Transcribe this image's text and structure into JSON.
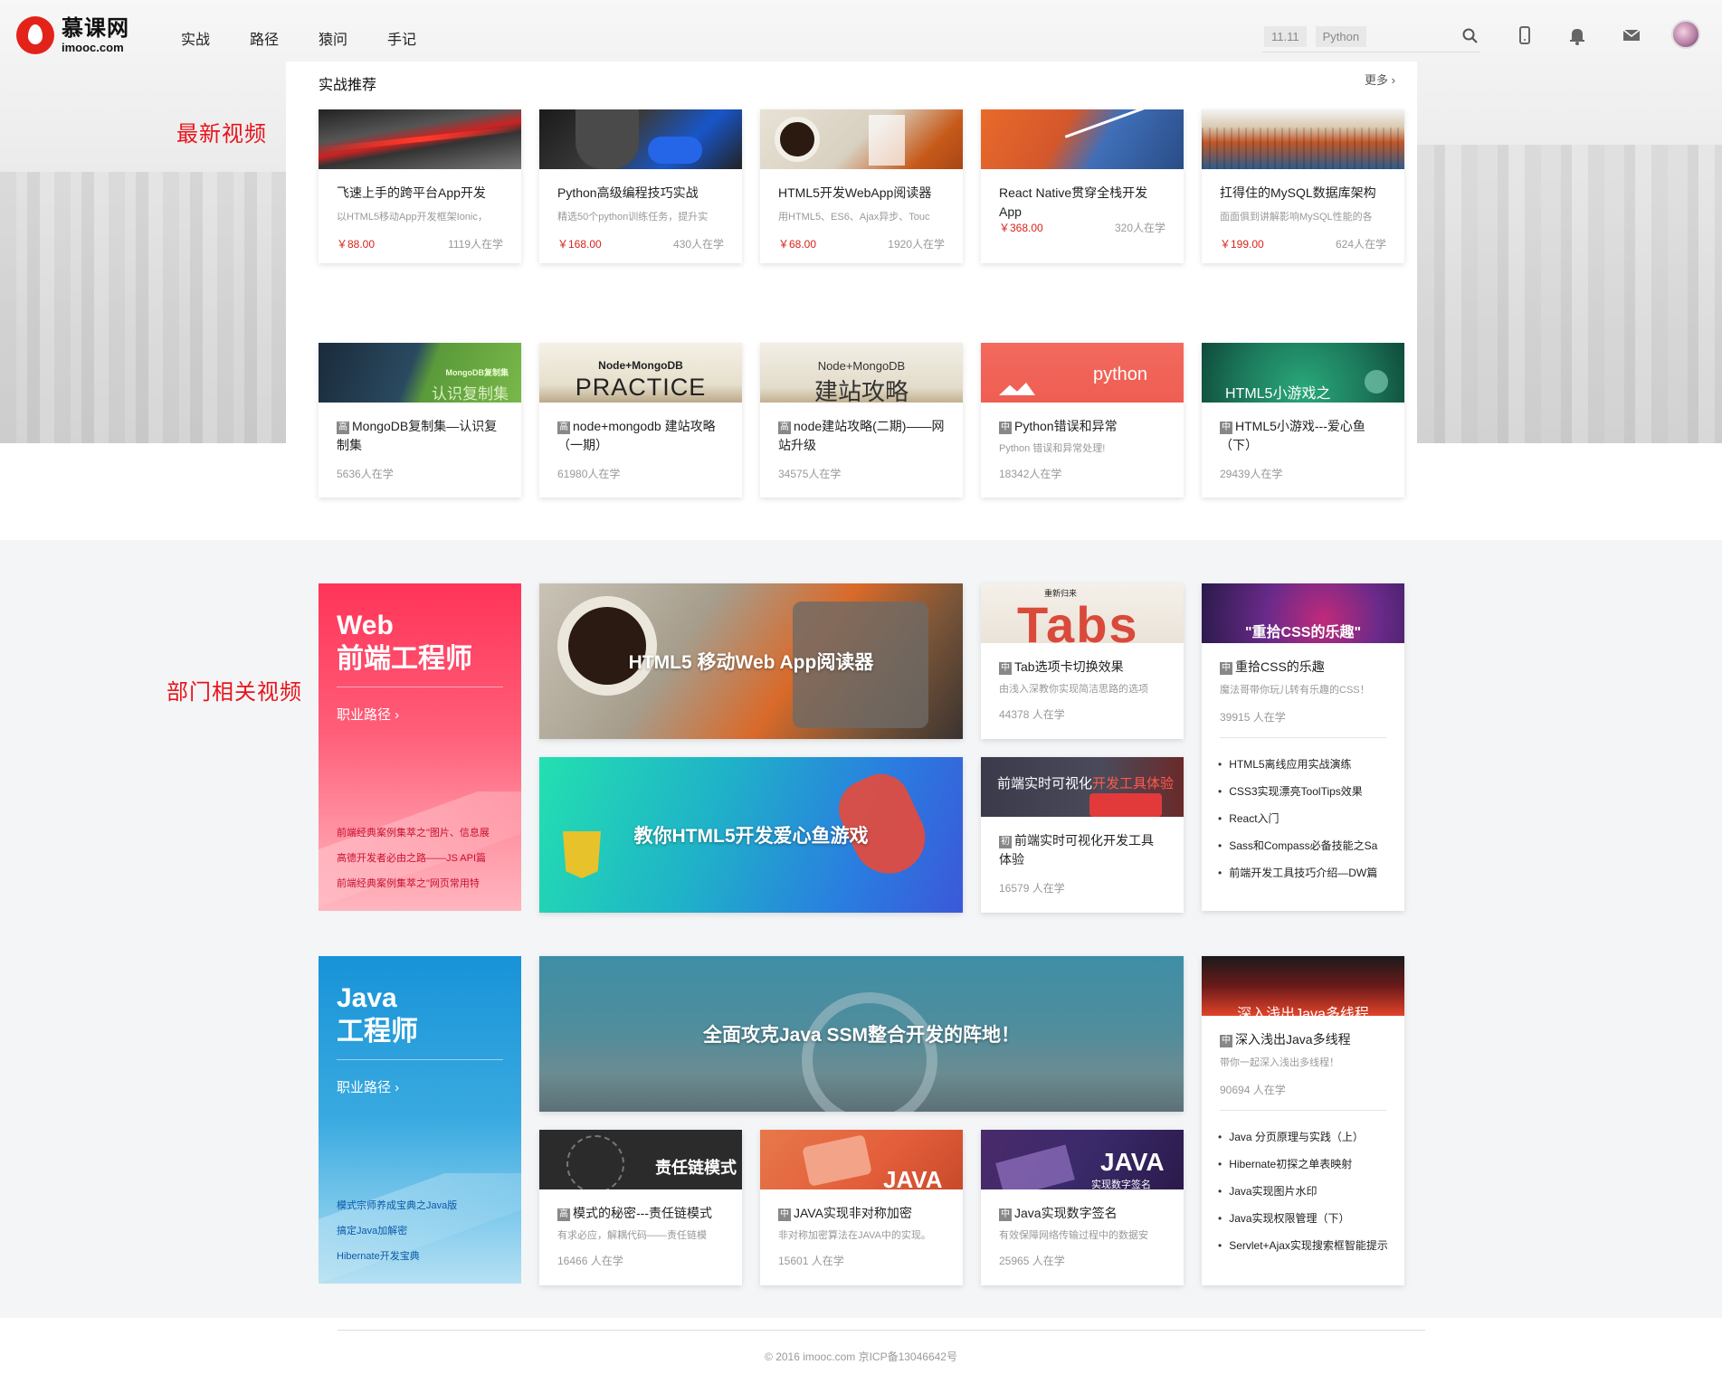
{
  "header": {
    "logo_cn": "慕课网",
    "logo_en": "imooc.com",
    "nav": [
      "实战",
      "路径",
      "猿问",
      "手记"
    ],
    "search_tags": [
      "11.11",
      "Python"
    ]
  },
  "side_labels": {
    "latest": "最新视频",
    "department": "部门相关视频"
  },
  "recommend": {
    "title": "实战推荐",
    "more": "更多 ›",
    "courses": [
      {
        "title": "飞速上手的跨平台App开发",
        "desc": "以HTML5移动App开发框架Ionic，",
        "price": "￥88.00",
        "students": "1119人在学"
      },
      {
        "title": "Python高级编程技巧实战",
        "desc": "精选50个python训练任务，提升实",
        "price": "￥168.00",
        "students": "430人在学"
      },
      {
        "title": "HTML5开发WebApp阅读器",
        "desc": "用HTML5、ES6、Ajax异步、Touc",
        "price": "￥68.00",
        "students": "1920人在学"
      },
      {
        "title": "React Native贯穿全栈开发App",
        "desc": "",
        "price": "￥368.00",
        "students": "320人在学"
      },
      {
        "title": "扛得住的MySQL数据库架构",
        "desc": "面面俱到讲解影响MySQL性能的各",
        "price": "￥199.00",
        "students": "624人在学"
      }
    ]
  },
  "latest": [
    {
      "level": "高",
      "title": "MongoDB复制集—认识复制集",
      "desc": "",
      "students": "5636人在学",
      "img_text": "认识复制集",
      "img_small": "MongoDB复制集"
    },
    {
      "level": "高",
      "title": "node+mongodb 建站攻略（一期）",
      "desc": "",
      "students": "61980人在学",
      "img_text": "PRACTICE",
      "img_small": "Node+MongoDB"
    },
    {
      "level": "高",
      "title": "node建站攻略(二期)——网站升级",
      "desc": "",
      "students": "34575人在学",
      "img_text": "建站攻略",
      "img_small": "Node+MongoDB"
    },
    {
      "level": "中",
      "title": "Python错误和异常",
      "desc": "Python 错误和异常处理!",
      "students": "18342人在学",
      "img_text": "python",
      "img_small": ""
    },
    {
      "level": "中",
      "title": "HTML5小游戏---爱心鱼（下）",
      "desc": "",
      "students": "29439人在学",
      "img_text": "HTML5小游戏之",
      "img_small": ""
    }
  ],
  "web": {
    "career_title_1": "Web",
    "career_title_2": "前端工程师",
    "career_path": "职业路径 ›",
    "career_links": [
      "前端经典案例集萃之\"图片、信息展",
      "高德开发者必由之路——JS API篇",
      "前端经典案例集萃之\"网页常用特"
    ],
    "banner1": "HTML5 移动Web App阅读器",
    "banner2": "教你HTML5开发爱心鱼游戏",
    "card1": {
      "level": "中",
      "title": "Tab选项卡切换效果",
      "desc": "由浅入深教你实现简洁思路的选项",
      "students": "44378 人在学",
      "img_text": "Tabs",
      "img_small": "重新归来"
    },
    "card2": {
      "level": "中",
      "title": "重拾CSS的乐趣",
      "desc": "魔法哥带你玩儿转有乐趣的CSS！",
      "students": "39915 人在学",
      "img_text": "\"重拾CSS的乐趣\""
    },
    "card3": {
      "level": "初",
      "title": "前端实时可视化开发工具体验",
      "desc": "",
      "students": "16579 人在学",
      "img_text": "前端实时可视化",
      "img_accent": "开发工具体验"
    },
    "list": [
      "HTML5离线应用实战演练",
      "CSS3实现漂亮ToolTips效果",
      "React入门",
      "Sass和Compass必备技能之Sa",
      "前端开发工具技巧介绍—DW篇"
    ]
  },
  "java": {
    "career_title_1": "Java",
    "career_title_2": "工程师",
    "career_path": "职业路径 ›",
    "career_links": [
      "模式宗师养成宝典之Java版",
      "搞定Java加解密",
      "Hibernate开发宝典"
    ],
    "banner1": "全面攻克Java SSM整合开发的阵地！",
    "card_thread": {
      "level": "中",
      "title": "深入浅出Java多线程",
      "desc": "带你一起深入浅出多线程！",
      "students": "90694 人在学",
      "img_text": "深入浅出Java多线程"
    },
    "list": [
      "Java 分页原理与实践（上）",
      "Hibernate初探之单表映射",
      "Java实现图片水印",
      "Java实现权限管理（下）",
      "Servlet+Ajax实现搜索框智能提示"
    ],
    "cards": [
      {
        "level": "高",
        "title": "模式的秘密---责任链模式",
        "desc": "有求必应，解耦代码——责任链模",
        "students": "16466 人在学",
        "img_text": "责任链模式"
      },
      {
        "level": "中",
        "title": "JAVA实现非对称加密",
        "desc": "非对称加密算法在JAVA中的实现。",
        "students": "15601 人在学",
        "img_text": "JAVA"
      },
      {
        "level": "中",
        "title": "Java实现数字签名",
        "desc": "有效保障网络传输过程中的数据安",
        "students": "25965 人在学",
        "img_text": "JAVA",
        "img_small": "实现数字签名"
      }
    ]
  },
  "footer": {
    "copyright": "© 2016 imooc.com  京ICP备13046642号"
  },
  "colors": {
    "accent_red": "#d9231a",
    "label_red": "#e8141c",
    "web_gradient_top": "#ff3b5c",
    "java_gradient_top": "#1a97d8"
  }
}
